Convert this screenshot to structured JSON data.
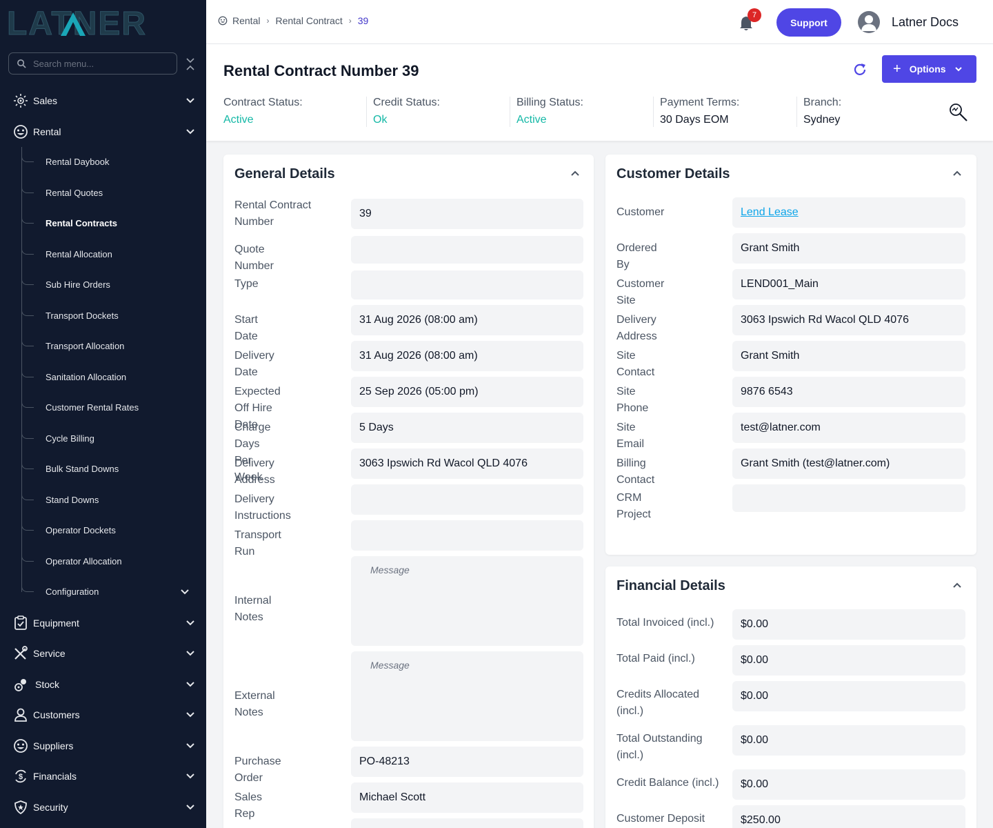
{
  "sidebar": {
    "logo_text": "LATNER",
    "search_placeholder": "Search menu...",
    "sections": [
      {
        "label": "Sales"
      },
      {
        "label": "Rental"
      }
    ],
    "rental_items": [
      {
        "label": "Rental Daybook"
      },
      {
        "label": "Rental Quotes"
      },
      {
        "label": "Rental Contracts"
      },
      {
        "label": "Rental Allocation"
      },
      {
        "label": "Sub Hire Orders"
      },
      {
        "label": "Transport Dockets"
      },
      {
        "label": "Transport Allocation"
      },
      {
        "label": "Sanitation Allocation"
      },
      {
        "label": "Customer Rental Rates"
      },
      {
        "label": "Cycle Billing"
      },
      {
        "label": "Bulk Stand Downs"
      },
      {
        "label": "Stand Downs"
      },
      {
        "label": "Operator Dockets"
      },
      {
        "label": "Operator Allocation"
      },
      {
        "label": "Configuration"
      }
    ],
    "lower_sections": [
      {
        "label": "Equipment"
      },
      {
        "label": "Service"
      },
      {
        "label": "Stock"
      },
      {
        "label": "Customers"
      },
      {
        "label": "Suppliers"
      },
      {
        "label": "Financials"
      },
      {
        "label": "Security"
      }
    ]
  },
  "header": {
    "breadcrumb": [
      "Rental",
      "Rental Contract",
      "39"
    ],
    "notification_count": "7",
    "support_label": "Support",
    "user_name": "Latner Docs"
  },
  "title": {
    "label": "Rental Contract Number",
    "number": "39",
    "options_label": "Options"
  },
  "status": [
    {
      "key": "Contract Status:",
      "value": "Active"
    },
    {
      "key": "Credit Status:",
      "value": "Ok"
    },
    {
      "key": "Billing Status:",
      "value": "Active"
    },
    {
      "key": "Payment Terms:",
      "value": "30 Days EOM"
    },
    {
      "key": "Branch:",
      "value": "Sydney"
    }
  ],
  "general": {
    "title": "General Details",
    "fields": [
      {
        "label": "Rental Contract Number",
        "value": "39"
      },
      {
        "label": "Quote Number",
        "value": ""
      },
      {
        "label": "Type",
        "value": ""
      },
      {
        "label": "Start Date",
        "value": "31 Aug 2026 (08:00 am)"
      },
      {
        "label": "Delivery Date",
        "value": "31 Aug 2026 (08:00 am)"
      },
      {
        "label": "Expected Off Hire Date",
        "value": "25 Sep 2026 (05:00 pm)"
      },
      {
        "label": "Charge Days Per Week",
        "value": "5 Days"
      },
      {
        "label": "Delivery Address",
        "value": "3063 Ipswich Rd Wacol QLD 4076"
      },
      {
        "label": "Delivery Instructions",
        "value": ""
      },
      {
        "label": "Transport Run",
        "value": ""
      },
      {
        "label": "Internal Notes",
        "value": "",
        "placeholder": "Message"
      },
      {
        "label": "External Notes",
        "value": "",
        "placeholder": "Message"
      },
      {
        "label": "Purchase Order",
        "value": "PO-48213"
      },
      {
        "label": "Sales Rep",
        "value": "Michael Scott"
      }
    ]
  },
  "customer": {
    "title": "Customer Details",
    "fields": [
      {
        "label": "Customer",
        "value": "Lend Lease"
      },
      {
        "label": "Ordered By",
        "value": "Grant Smith"
      },
      {
        "label": "Customer Site",
        "value": "LEND001_Main"
      },
      {
        "label": "Delivery Address",
        "value": "3063 Ipswich Rd Wacol QLD 4076"
      },
      {
        "label": "Site Contact",
        "value": "Grant Smith"
      },
      {
        "label": "Site Phone",
        "value": "9876 6543"
      },
      {
        "label": "Site Email",
        "value": "test@latner.com"
      },
      {
        "label": "Billing Contact",
        "value": "Grant Smith (test@latner.com)"
      },
      {
        "label": "CRM Project",
        "value": ""
      }
    ]
  },
  "financial": {
    "title": "Financial Details",
    "fields": [
      {
        "label": "Total Invoiced (incl.)",
        "value": "$0.00"
      },
      {
        "label": "Total Paid (incl.)",
        "value": "$0.00"
      },
      {
        "label": "Credits Allocated (incl.)",
        "value": "$0.00"
      },
      {
        "label": "Total Outstanding (incl.)",
        "value": "$0.00"
      },
      {
        "label": "Credit Balance (incl.)",
        "value": "$0.00"
      },
      {
        "label": "Customer Deposit",
        "value": "$250.00"
      }
    ]
  },
  "colors": {
    "sidebar_bg": "#111a2e",
    "accent": "#4f46e5",
    "status_green": "#14b8a6",
    "link": "#0ea5e9",
    "badge": "#dc2626"
  }
}
